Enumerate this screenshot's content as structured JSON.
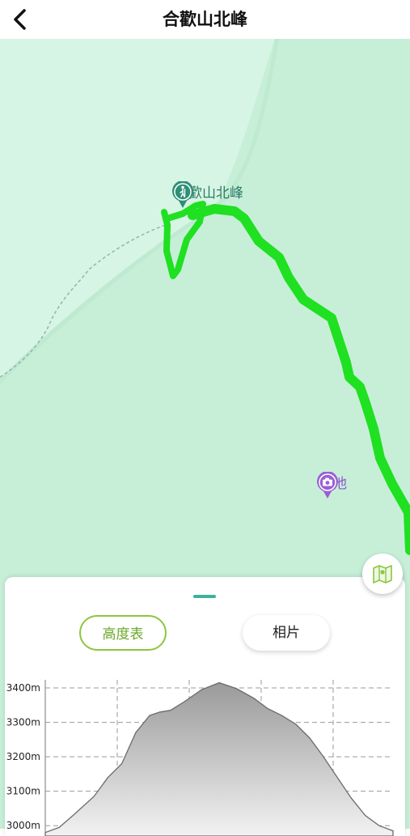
{
  "header": {
    "title": "合歡山北峰",
    "back_icon": "chevron-left-icon"
  },
  "map": {
    "summit": {
      "label": "合歡山北峰",
      "icon": "hiker-icon",
      "color": "#2d8f76"
    },
    "photo_spot": {
      "label": "碧池",
      "icon": "camera-icon",
      "color": "#9a5fd6"
    },
    "route_color": "#17e01b",
    "layer_button_icon": "map-layers-icon"
  },
  "panel": {
    "tabs": [
      {
        "label": "高度表",
        "active": true
      },
      {
        "label": "相片",
        "active": false
      }
    ]
  },
  "chart_data": {
    "type": "area",
    "y_ticks": [
      "3400m",
      "3300m",
      "3200m",
      "3100m",
      "3000m"
    ],
    "ylim": [
      2970,
      3440
    ],
    "x": [
      0,
      4,
      8,
      14,
      18,
      22,
      26,
      30,
      33,
      36,
      40,
      45,
      50,
      55,
      60,
      64,
      68,
      72,
      76,
      80,
      84,
      88,
      92,
      96,
      100
    ],
    "values": [
      2980,
      2995,
      3030,
      3085,
      3140,
      3180,
      3270,
      3320,
      3330,
      3335,
      3360,
      3395,
      3415,
      3398,
      3370,
      3340,
      3320,
      3295,
      3255,
      3200,
      3140,
      3080,
      3030,
      3000,
      2985
    ],
    "grid": true,
    "fill_gradient": [
      "#9a9a9a",
      "#f2f2f2"
    ]
  }
}
